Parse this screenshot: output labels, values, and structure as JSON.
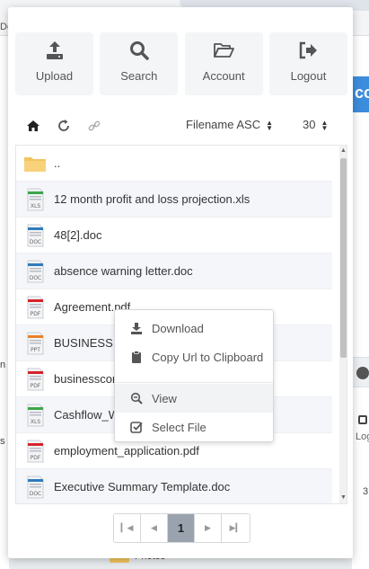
{
  "background": {
    "left_fragment_1": "De",
    "right_fragment_blue": "cc",
    "right_fragment_log": "Log",
    "right_fragment_num": "3",
    "left_fragment_n": "n",
    "left_fragment_s": "s",
    "photos_label": "Photos"
  },
  "toolbar": {
    "upload": "Upload",
    "search": "Search",
    "account": "Account",
    "logout": "Logout"
  },
  "navbar": {
    "sort_label": "Filename ASC",
    "per_page": "30"
  },
  "files": [
    {
      "name": "..",
      "icon": "folder-icon"
    },
    {
      "name": "12 month profit and loss projection.xls",
      "icon": "xls-icon"
    },
    {
      "name": "48[2].doc",
      "icon": "doc-icon"
    },
    {
      "name": "absence warning letter.doc",
      "icon": "doc-icon"
    },
    {
      "name": "Agreement.pdf",
      "icon": "pdf-icon"
    },
    {
      "name": "BUSINESS I",
      "icon": "ppt-icon"
    },
    {
      "name": "businesscor",
      "icon": "pdf-icon"
    },
    {
      "name": "Cashflow_W",
      "icon": "xls-icon"
    },
    {
      "name": "employment_application.pdf",
      "icon": "pdf-icon"
    },
    {
      "name": "Executive Summary Template.doc",
      "icon": "doc-icon"
    }
  ],
  "context_menu": {
    "download": "Download",
    "copy_url": "Copy Url to Clipboard",
    "view": "View",
    "select_file": "Select File"
  },
  "pagination": {
    "current_page": "1"
  },
  "colors": {
    "folder": "#f3c45e",
    "xls": "#3aa648",
    "doc": "#2e7bbd",
    "pdf": "#d6242a",
    "ppt": "#e8822b",
    "accent_blue": "#3c8dde"
  }
}
